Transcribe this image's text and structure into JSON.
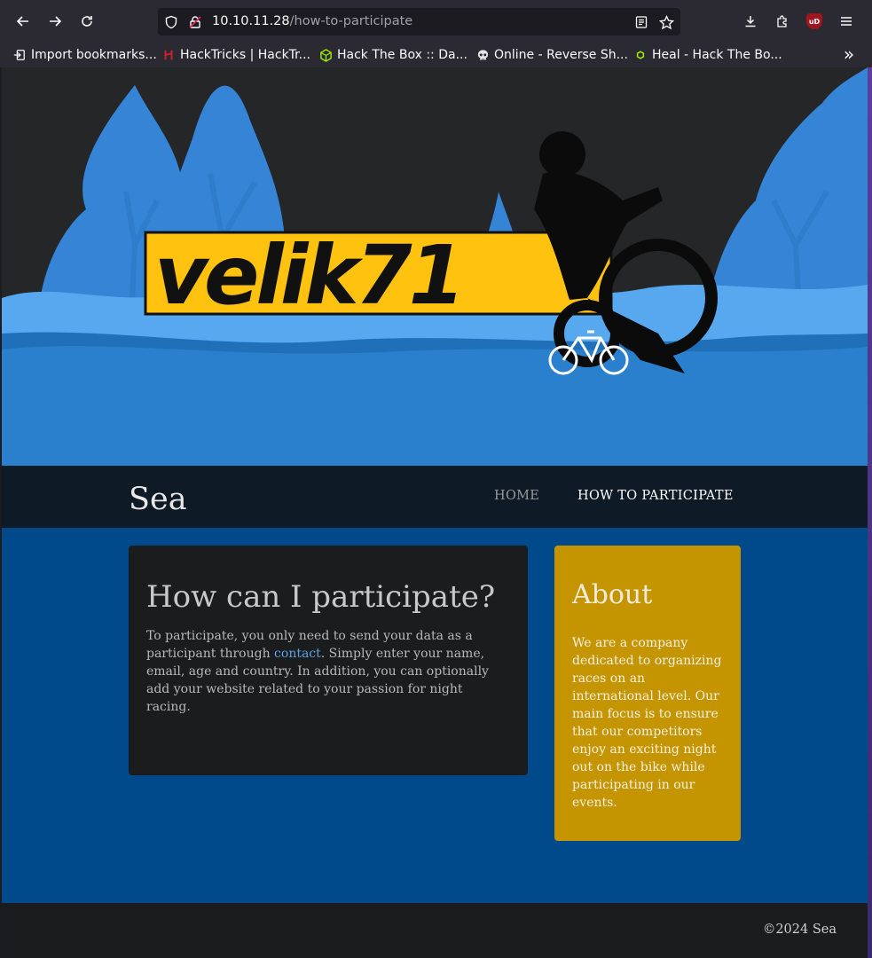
{
  "browser": {
    "url_host": "10.10.11.28",
    "url_path": "/how-to-participate",
    "bookmarks": [
      {
        "label": "Import bookmarks...",
        "icon": "import-icon"
      },
      {
        "label": "HackTricks | HackTr...",
        "icon": "hacktricks-icon"
      },
      {
        "label": "Hack The Box :: Da...",
        "icon": "htb-cube-icon"
      },
      {
        "label": "Online - Reverse Sh...",
        "icon": "skull-icon"
      },
      {
        "label": "Heal - Hack The Bo...",
        "icon": "htb-small-icon"
      }
    ],
    "ublock_badge": "uD"
  },
  "banner": {
    "logo_text": "velik71",
    "colors": {
      "sky": "#252628",
      "trees": "#3a8fe0",
      "ground": "#2a80cc",
      "logo_bg": "#ffc20e"
    }
  },
  "site": {
    "brand": "Sea",
    "nav": {
      "home": "HOME",
      "how": "HOW TO PARTICIPATE"
    }
  },
  "main": {
    "title": "How can I participate?",
    "text_before_link": "To participate, you only need to send your data as a participant through ",
    "link_text": "contact",
    "text_after_link": ". Simply enter your name, email, age and country. In addition, you can optionally add your website related to your passion for night racing."
  },
  "about": {
    "title": "About",
    "text": "We are a company dedicated to organizing races on an international level. Our main focus is to ensure that our competitors enjoy an exciting night out on the bike while participating in our events."
  },
  "footer": {
    "copyright": "©2024 Sea"
  }
}
